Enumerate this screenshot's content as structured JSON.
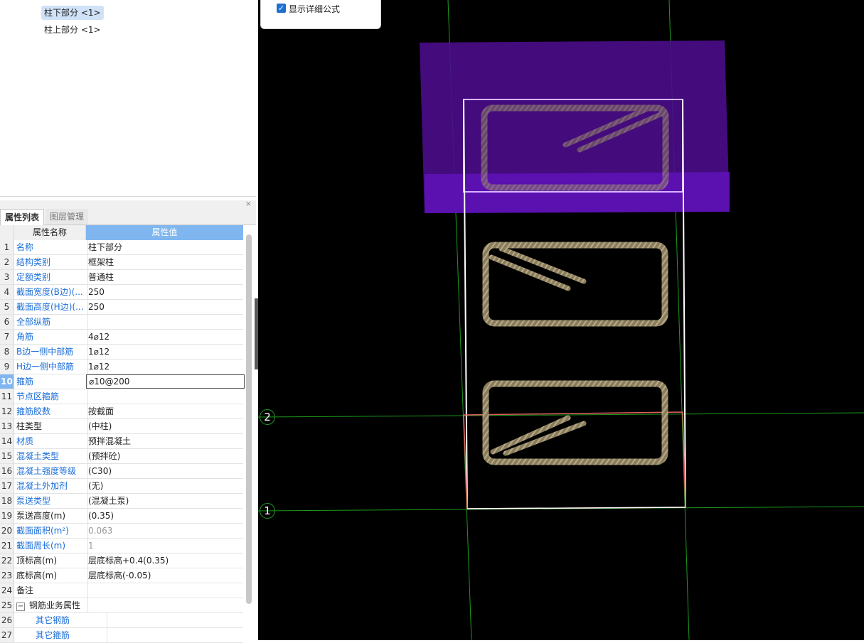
{
  "tree": {
    "items": [
      {
        "label": "柱下部分 <1>",
        "selected": true
      },
      {
        "label": "柱上部分 <1>",
        "selected": false
      }
    ]
  },
  "panel": {
    "close": "×",
    "tabs": [
      "属性列表",
      "图层管理"
    ],
    "columns": [
      "属性名称",
      "属性值"
    ],
    "rows": [
      {
        "no": "1",
        "name": "名称",
        "value": "柱下部分",
        "name_blue": true
      },
      {
        "no": "2",
        "name": "结构类别",
        "value": "框架柱",
        "name_blue": true
      },
      {
        "no": "3",
        "name": "定额类别",
        "value": "普通柱",
        "name_blue": true
      },
      {
        "no": "4",
        "name": "截面宽度(B边)(...",
        "value": "250",
        "name_blue": true
      },
      {
        "no": "5",
        "name": "截面高度(H边)(...",
        "value": "250",
        "name_blue": true
      },
      {
        "no": "6",
        "name": "全部纵筋",
        "value": "",
        "name_blue": true
      },
      {
        "no": "7",
        "name": "角筋",
        "value": "4⌀12",
        "name_blue": true
      },
      {
        "no": "8",
        "name": "B边一侧中部筋",
        "value": "1⌀12",
        "name_blue": true
      },
      {
        "no": "9",
        "name": "H边一侧中部筋",
        "value": "1⌀12",
        "name_blue": true
      },
      {
        "no": "10",
        "name": "箍筋",
        "value": "⌀10@200",
        "name_blue": true,
        "selected": true
      },
      {
        "no": "11",
        "name": "节点区箍筋",
        "value": "",
        "name_blue": true
      },
      {
        "no": "12",
        "name": "箍筋胶数",
        "value": "按截面",
        "name_blue": true
      },
      {
        "no": "13",
        "name": "柱类型",
        "value": "(中柱)",
        "name_blue": false
      },
      {
        "no": "14",
        "name": "材质",
        "value": "预拌混凝土",
        "name_blue": true
      },
      {
        "no": "15",
        "name": "混凝土类型",
        "value": "(预拌砼)",
        "name_blue": true
      },
      {
        "no": "16",
        "name": "混凝土强度等级",
        "value": "(C30)",
        "name_blue": true
      },
      {
        "no": "17",
        "name": "混凝土外加剂",
        "value": "(无)",
        "name_blue": true
      },
      {
        "no": "18",
        "name": "泵送类型",
        "value": "(混凝土泵)",
        "name_blue": true
      },
      {
        "no": "19",
        "name": "泵送高度(m)",
        "value": "(0.35)",
        "name_blue": false
      },
      {
        "no": "20",
        "name": "截面面积(m²)",
        "value": "0.063",
        "name_blue": true,
        "value_gray": true
      },
      {
        "no": "21",
        "name": "截面周长(m)",
        "value": "1",
        "name_blue": true,
        "value_gray": true
      },
      {
        "no": "22",
        "name": "顶标高(m)",
        "value": "层底标高+0.4(0.35)",
        "name_blue": false
      },
      {
        "no": "23",
        "name": "底标高(m)",
        "value": "层底标高(-0.05)",
        "name_blue": false
      },
      {
        "no": "24",
        "name": "备注",
        "value": "",
        "name_blue": false
      },
      {
        "no": "25",
        "name": "钢筋业务属性",
        "value": "",
        "name_blue": false,
        "group": true,
        "toggle": "−"
      },
      {
        "no": "26",
        "name": "其它钢筋",
        "value": "",
        "name_blue": true,
        "child": true
      },
      {
        "no": "27",
        "name": "其它箍筋",
        "value": "",
        "name_blue": true,
        "child": true
      }
    ]
  },
  "viewport": {
    "checkbox_label": "显示详细公式",
    "checkbox_checked": true,
    "axis_labels": [
      "2",
      "1"
    ],
    "colors": {
      "background": "#000000",
      "slab": "#5a0fa8",
      "grid": "#1e9a1e",
      "rebar": "#8a7d5e"
    }
  }
}
